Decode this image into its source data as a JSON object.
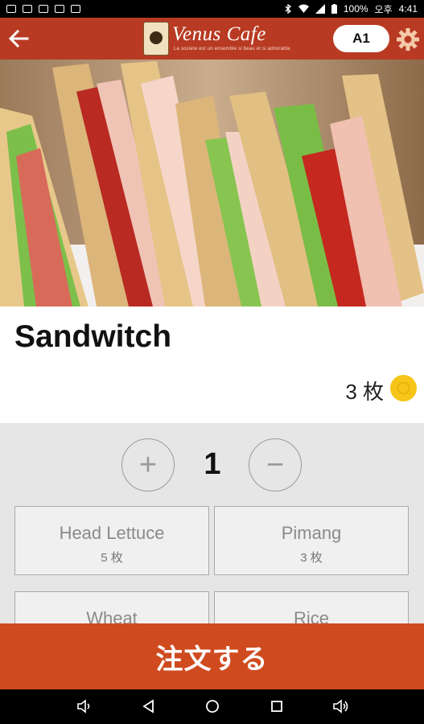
{
  "status_bar": {
    "battery": "100%",
    "ampm": "오후",
    "time": "4:41"
  },
  "app_bar": {
    "logo_text": "Venus Cafe",
    "logo_subtitle": "La societe est un ensemble si beau et si admirable",
    "table_label": "A1"
  },
  "product": {
    "name": "Sandwitch",
    "price": "3 枚"
  },
  "quantity": {
    "plus_label": "+",
    "value": "1",
    "minus_label": "−"
  },
  "options": [
    {
      "name": "Head Lettuce",
      "price": "5 枚"
    },
    {
      "name": "Pimang",
      "price": "3 枚"
    },
    {
      "name": "Wheat",
      "price": ""
    },
    {
      "name": "Rice",
      "price": ""
    }
  ],
  "order_button": "注文する",
  "colors": {
    "header": "#b83a22",
    "order_button": "#cf4b1f",
    "coin": "#f5c518"
  }
}
